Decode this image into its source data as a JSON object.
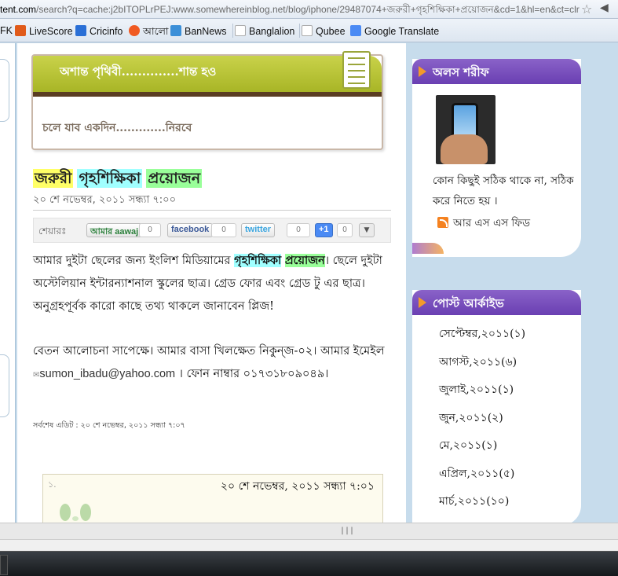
{
  "browser": {
    "url_host": "tent.com",
    "url_rest": "/search?q=cache:j2bITOPLrPEJ:www.somewhereinblog.net/blog/iphone/29487074+জরুরী+গৃহশিক্ষিকা+প্রয়োজন&cd=1&hl=en&ct=clr",
    "star_icon": "☆",
    "wrench_icon": "◀"
  },
  "bookmarks": [
    {
      "label": "FK",
      "icon_color": "#ffffff"
    },
    {
      "label": "LiveScore",
      "icon_color": "#e05a1a"
    },
    {
      "label": "Cricinfo",
      "icon_color": "#2a6fd6"
    },
    {
      "label": "আলো",
      "icon_color": "#f05a22"
    },
    {
      "label": "BanNews",
      "icon_color": "#3b8fd8"
    },
    {
      "label": "Banglalion",
      "icon_color": "#ffffff"
    },
    {
      "label": "Qubee",
      "icon_color": "#ffffff"
    },
    {
      "label": "Google Translate",
      "icon_color": "#4a8af4"
    }
  ],
  "banner": {
    "title": "অশান্ত পৃথিবী..............শান্ত হও",
    "subtitle": "চলে যাব একদিন.............নিরবে"
  },
  "post": {
    "title_words": [
      "জরুরী",
      "গৃহশিক্ষিকা",
      "প্রয়োজন"
    ],
    "date": "২০ শে নভেম্বর, ২০১১ সন্ধ্যা ৭:০০",
    "share_label": "শেয়ারঃ",
    "share_buttons": [
      {
        "label": "আমার aawaj",
        "count": "0"
      },
      {
        "label": "facebook",
        "count": "0"
      },
      {
        "label": "twitter",
        "count": "0"
      },
      {
        "label": "+1",
        "count": "0"
      }
    ],
    "more_icon": "▼",
    "para1_a": "আমার দুইটা ছেলের জন্য ইংলিশ মিডিয়ামের ",
    "para1_b": "গৃহশিক্ষিকা",
    "para1_c": "প্রয়োজন",
    "para1_d": "। ছেলে দুইটা অস্টেলিয়ান ইন্টারন্যাশনাল স্কুলের ছাত্র। গ্রেড ফোর এবং গ্রেড টু এর ছাত্র। অনুগ্রহপূর্বক কারো কাছে তথ্য থাকলে জানাবেন প্লিজ!",
    "para2_a": "বেতন আলোচনা সাপেক্ষে। আমার বাসা খিলক্ষেত নিকুন্জ-০২। আমার ইমেইল ",
    "email": "sumon_ibadu@yahoo.com",
    "para2_b": " । ফোন নাম্বার ০১৭৩১৮০৯০৪৯।",
    "edited": "সর্বশেষ এডিট : ২০ শে নভেম্বর, ২০১১ সন্ধ্যা ৭:০৭"
  },
  "comment": {
    "number": "১.",
    "date": "২০ শে নভেম্বর, ২০১১ সন্ধ্যা ৭:০১"
  },
  "sidebar": {
    "profile": {
      "title": "অলস শরীফ",
      "text": "কোন কিছুই সঠিক থাকে না, সঠিক করে নিতে হয় ।",
      "rss": "আর এস এস ফিড"
    },
    "archive": {
      "title": "পোস্ট আর্কাইভ",
      "items": [
        "সেপ্টেম্বর,২০১১(১)",
        "আগস্ট,২০১১(৬)",
        "জুলাই,২০১১(১)",
        "জুন,২০১১(২)",
        "মে,২০১১(১)",
        "এপ্রিল,২০১১(৫)",
        "মার্চ,২০১১(১০)"
      ]
    }
  },
  "scroll_grip": "|||"
}
